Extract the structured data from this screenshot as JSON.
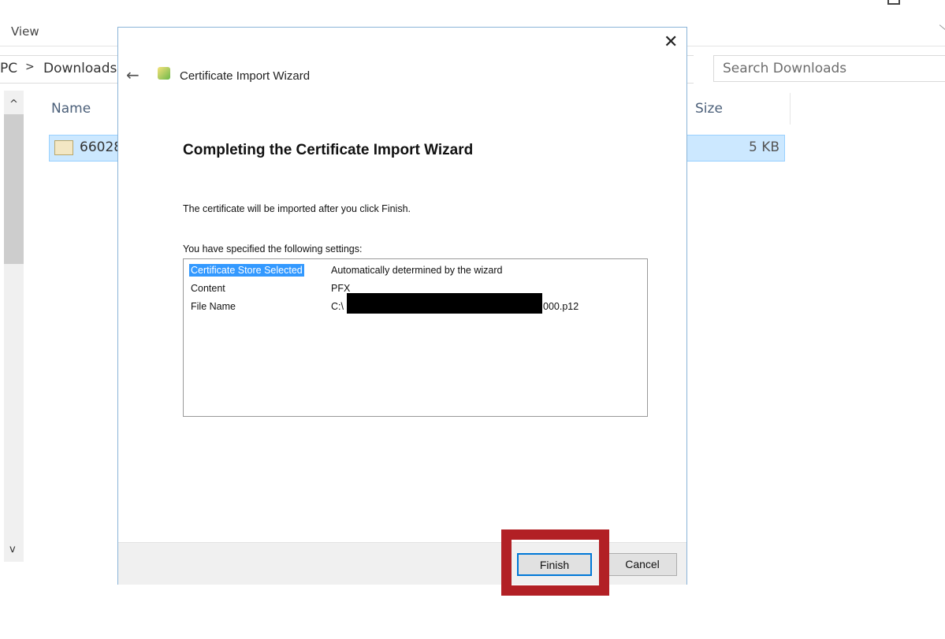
{
  "explorer": {
    "menu_view": "View",
    "breadcrumb": [
      "PC",
      "Downloads"
    ],
    "breadcrumb_separator": ">",
    "search_placeholder": "Search Downloads",
    "columns": {
      "name": "Name",
      "size": "Size"
    },
    "file": {
      "name": "66028",
      "size": "5 KB"
    }
  },
  "dialog": {
    "title": "Certificate Import Wizard",
    "heading": "Completing the Certificate Import Wizard",
    "info": "The certificate will be imported after you click Finish.",
    "settings_label": "You have specified the following settings:",
    "settings": [
      {
        "key": "Certificate Store Selected",
        "value": "Automatically determined by the wizard"
      },
      {
        "key": "Content",
        "value": "PFX"
      },
      {
        "key": "File Name",
        "value_prefix": "C:\\",
        "value_suffix": "000.p12"
      }
    ],
    "finish_label": "Finish",
    "cancel_label": "Cancel"
  },
  "colors": {
    "highlight": "#b22025",
    "selection": "#3399ff",
    "dialog_border": "#8ab4d8"
  }
}
